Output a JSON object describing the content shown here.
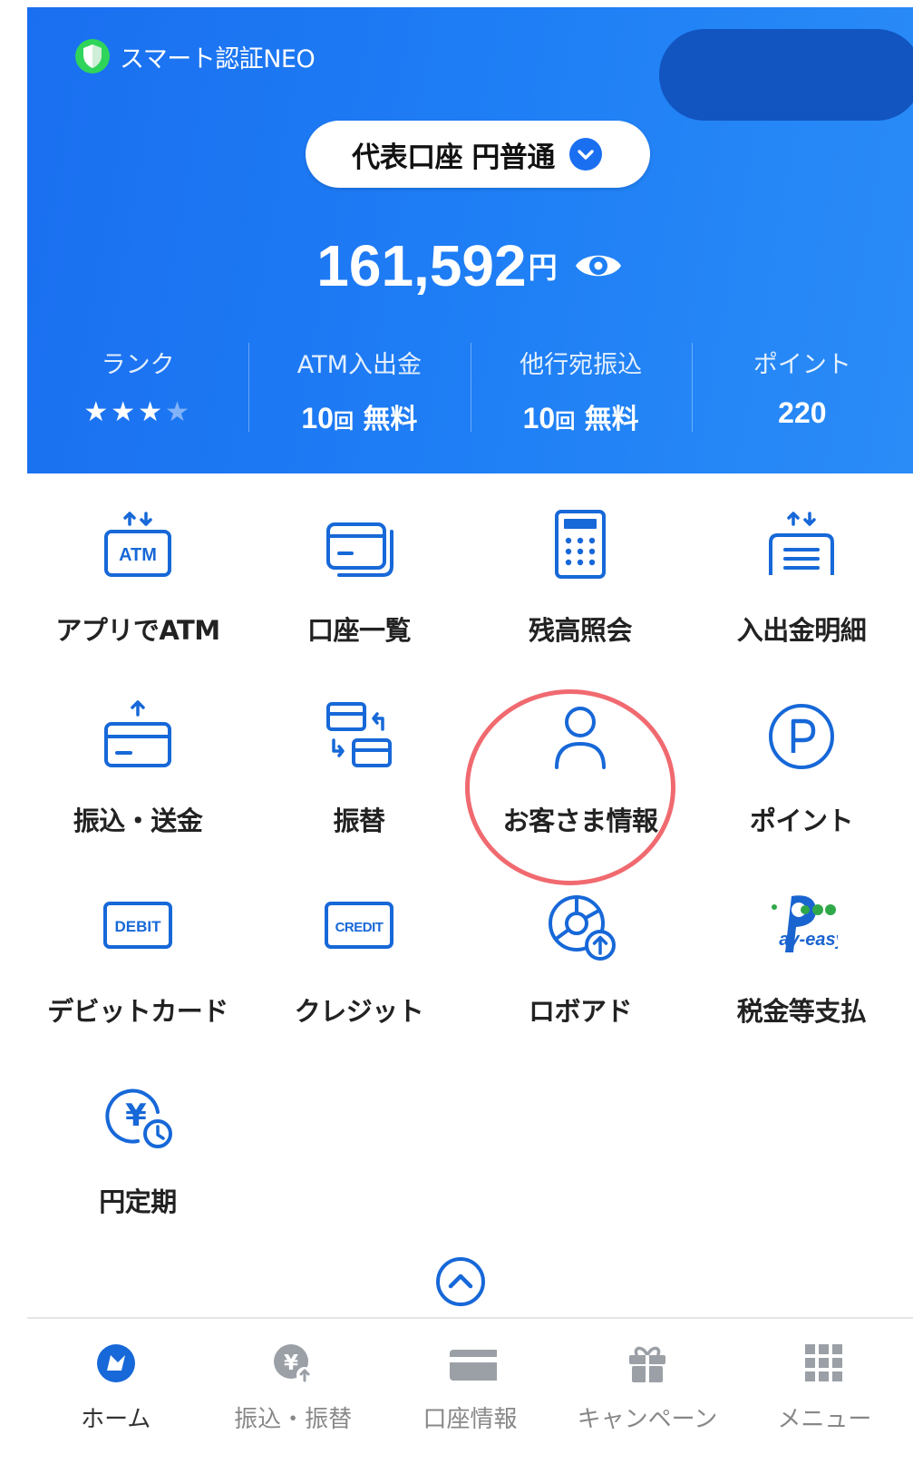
{
  "header": {
    "auth_label": "スマート認証NEO",
    "account_label": "代表口座 円普通",
    "balance": {
      "amount": "161,592",
      "unit": "円"
    },
    "stats": [
      {
        "label": "ランク",
        "stars_filled": 3,
        "stars_total": 4
      },
      {
        "label": "ATM入出金",
        "count": "10",
        "count_unit": "回",
        "suffix": "無料"
      },
      {
        "label": "他行宛振込",
        "count": "10",
        "count_unit": "回",
        "suffix": "無料"
      },
      {
        "label": "ポイント",
        "value": "220"
      }
    ]
  },
  "menu": {
    "items": [
      {
        "label": "アプリでATM",
        "icon": "atm-icon"
      },
      {
        "label": "口座一覧",
        "icon": "card-icon"
      },
      {
        "label": "残高照会",
        "icon": "calculator-icon"
      },
      {
        "label": "入出金明細",
        "icon": "statement-icon"
      },
      {
        "label": "振込・送金",
        "icon": "transfer-icon"
      },
      {
        "label": "振替",
        "icon": "swap-icon"
      },
      {
        "label": "お客さま情報",
        "icon": "user-icon"
      },
      {
        "label": "ポイント",
        "icon": "point-icon"
      },
      {
        "label": "デビットカード",
        "icon": "debit-icon",
        "badge": "DEBIT"
      },
      {
        "label": "クレジット",
        "icon": "credit-icon",
        "badge": "CREDIT"
      },
      {
        "label": "ロボアド",
        "icon": "robo-advisor-icon"
      },
      {
        "label": "税金等支払",
        "icon": "pay-easy-logo",
        "logo_text": "ay-easy"
      },
      {
        "label": "円定期",
        "icon": "yen-deposit-icon",
        "symbol": "¥"
      }
    ]
  },
  "tabbar": {
    "active": 0,
    "tabs": [
      {
        "label": "ホーム",
        "icon": "home-icon"
      },
      {
        "label": "振込・振替",
        "icon": "transfer-yen-icon",
        "symbol": "¥"
      },
      {
        "label": "口座情報",
        "icon": "card-icon"
      },
      {
        "label": "キャンペーン",
        "icon": "gift-icon"
      },
      {
        "label": "メニュー",
        "icon": "grid-menu-icon"
      }
    ]
  },
  "colors": {
    "brand_blue": "#1a6ff0",
    "icon_blue": "#1768d8",
    "highlight_red": "#f06a70",
    "auth_green": "#2fd45a"
  }
}
